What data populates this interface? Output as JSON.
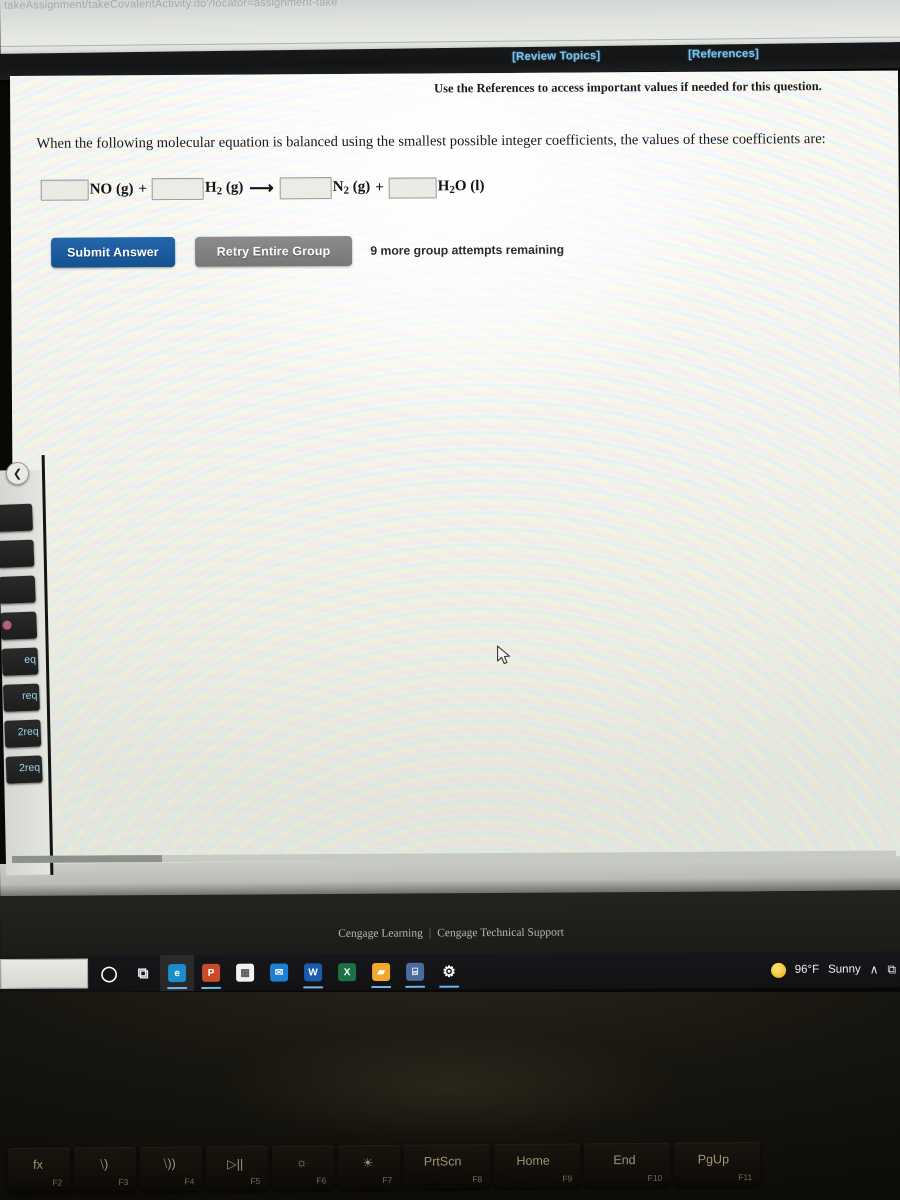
{
  "browser": {
    "url_ghost": "takeAssignment/takeCovalentActivity.do?locator=assignment-take",
    "collapse_icon": "chevron-left-icon",
    "tabs": [
      {
        "label": "",
        "favicon": "none"
      },
      {
        "label": "",
        "favicon": "none"
      },
      {
        "label": "",
        "favicon": "none"
      },
      {
        "label": "",
        "favicon": "record-icon"
      },
      {
        "label": "eq",
        "favicon": "none"
      },
      {
        "label": "req",
        "favicon": "none"
      },
      {
        "label": "2req",
        "favicon": "none"
      },
      {
        "label": "2req",
        "favicon": "none"
      }
    ]
  },
  "topbar": {
    "review_topics": "[Review Topics]",
    "references": "[References]",
    "link_color": "#79c6ef"
  },
  "page": {
    "reference_note": "Use the References to access important values if needed for this question.",
    "question": "When the following molecular equation is balanced using the smallest possible integer coefficients, the values of these coefficients are:",
    "equation": {
      "terms": [
        {
          "coefficient": "",
          "formula_html": "NO (g)"
        },
        {
          "coefficient": "",
          "formula_html": "H<sub>2</sub> (g)"
        },
        {
          "coefficient": "",
          "formula_html": "N<sub>2</sub> (g)"
        },
        {
          "coefficient": "",
          "formula_html": "H<sub>2</sub>O (l)"
        }
      ],
      "plus": "+",
      "arrow": "⟶",
      "placeholder": ""
    },
    "buttons": {
      "submit": "Submit Answer",
      "retry": "Retry Entire Group",
      "submit_color": "#1a5a9d",
      "retry_color": "#808080"
    },
    "attempts": "9 more group attempts remaining",
    "cursor_icon": "mouse-pointer-icon"
  },
  "footer": {
    "cengage_learning": "Cengage Learning",
    "separator": "|",
    "cengage_support": "Cengage Technical Support"
  },
  "taskbar": {
    "items": [
      {
        "name": "search-icon",
        "glyph": "◯",
        "color": "#ffffff",
        "bg": "transparent",
        "active": false,
        "running": false
      },
      {
        "name": "task-view-icon",
        "glyph": "⧉",
        "color": "#e9eaec",
        "bg": "transparent",
        "active": false,
        "running": false
      },
      {
        "name": "edge-browser-icon",
        "glyph": "e",
        "color": "#ffffff",
        "bg": "#1a8ecb",
        "active": true,
        "running": true
      },
      {
        "name": "powerpoint-icon",
        "glyph": "P",
        "color": "#ffffff",
        "bg": "#c94b29",
        "active": false,
        "running": true
      },
      {
        "name": "microsoft-store-icon",
        "glyph": "▦",
        "color": "#5a5a5a",
        "bg": "#f2f2f2",
        "active": false,
        "running": false
      },
      {
        "name": "mail-icon",
        "glyph": "✉",
        "color": "#ffffff",
        "bg": "#1f7fd4",
        "active": false,
        "running": false
      },
      {
        "name": "word-icon",
        "glyph": "W",
        "color": "#ffffff",
        "bg": "#1b5bb0",
        "active": false,
        "running": true
      },
      {
        "name": "excel-icon",
        "glyph": "X",
        "color": "#ffffff",
        "bg": "#1e7145",
        "active": false,
        "running": false
      },
      {
        "name": "photos-icon",
        "glyph": "▰",
        "color": "#ffffff",
        "bg": "#f0a830",
        "active": false,
        "running": true
      },
      {
        "name": "calculator-icon",
        "glyph": "⌸",
        "color": "#ffffff",
        "bg": "#4b6c9e",
        "active": false,
        "running": true
      },
      {
        "name": "settings-gear-icon",
        "glyph": "⚙",
        "color": "#ffffff",
        "bg": "transparent",
        "active": false,
        "running": true
      }
    ],
    "weather": {
      "temperature": "96°F",
      "condition": "Sunny",
      "icon": "sun-icon"
    },
    "show_hidden_icons": "∧",
    "notification_icon": "⧉"
  },
  "keyboard": {
    "keys": [
      {
        "glyph": "fx",
        "fnum": "F2",
        "width": "w1"
      },
      {
        "glyph": "⧵)",
        "fnum": "F3",
        "width": "w1"
      },
      {
        "glyph": "⧵))",
        "fnum": "F4",
        "width": "w1"
      },
      {
        "glyph": "▷||",
        "fnum": "F5",
        "width": "w1"
      },
      {
        "glyph": "☼",
        "fnum": "F6",
        "width": "w1"
      },
      {
        "glyph": "☀",
        "fnum": "F7",
        "width": "w1"
      },
      {
        "glyph": "PrtScn",
        "fnum": "F8",
        "width": "w2"
      },
      {
        "glyph": "Home",
        "fnum": "F9",
        "width": "w2"
      },
      {
        "glyph": "End",
        "fnum": "F10",
        "width": "w2"
      },
      {
        "glyph": "PgUp",
        "fnum": "F11",
        "width": "w2"
      }
    ]
  }
}
